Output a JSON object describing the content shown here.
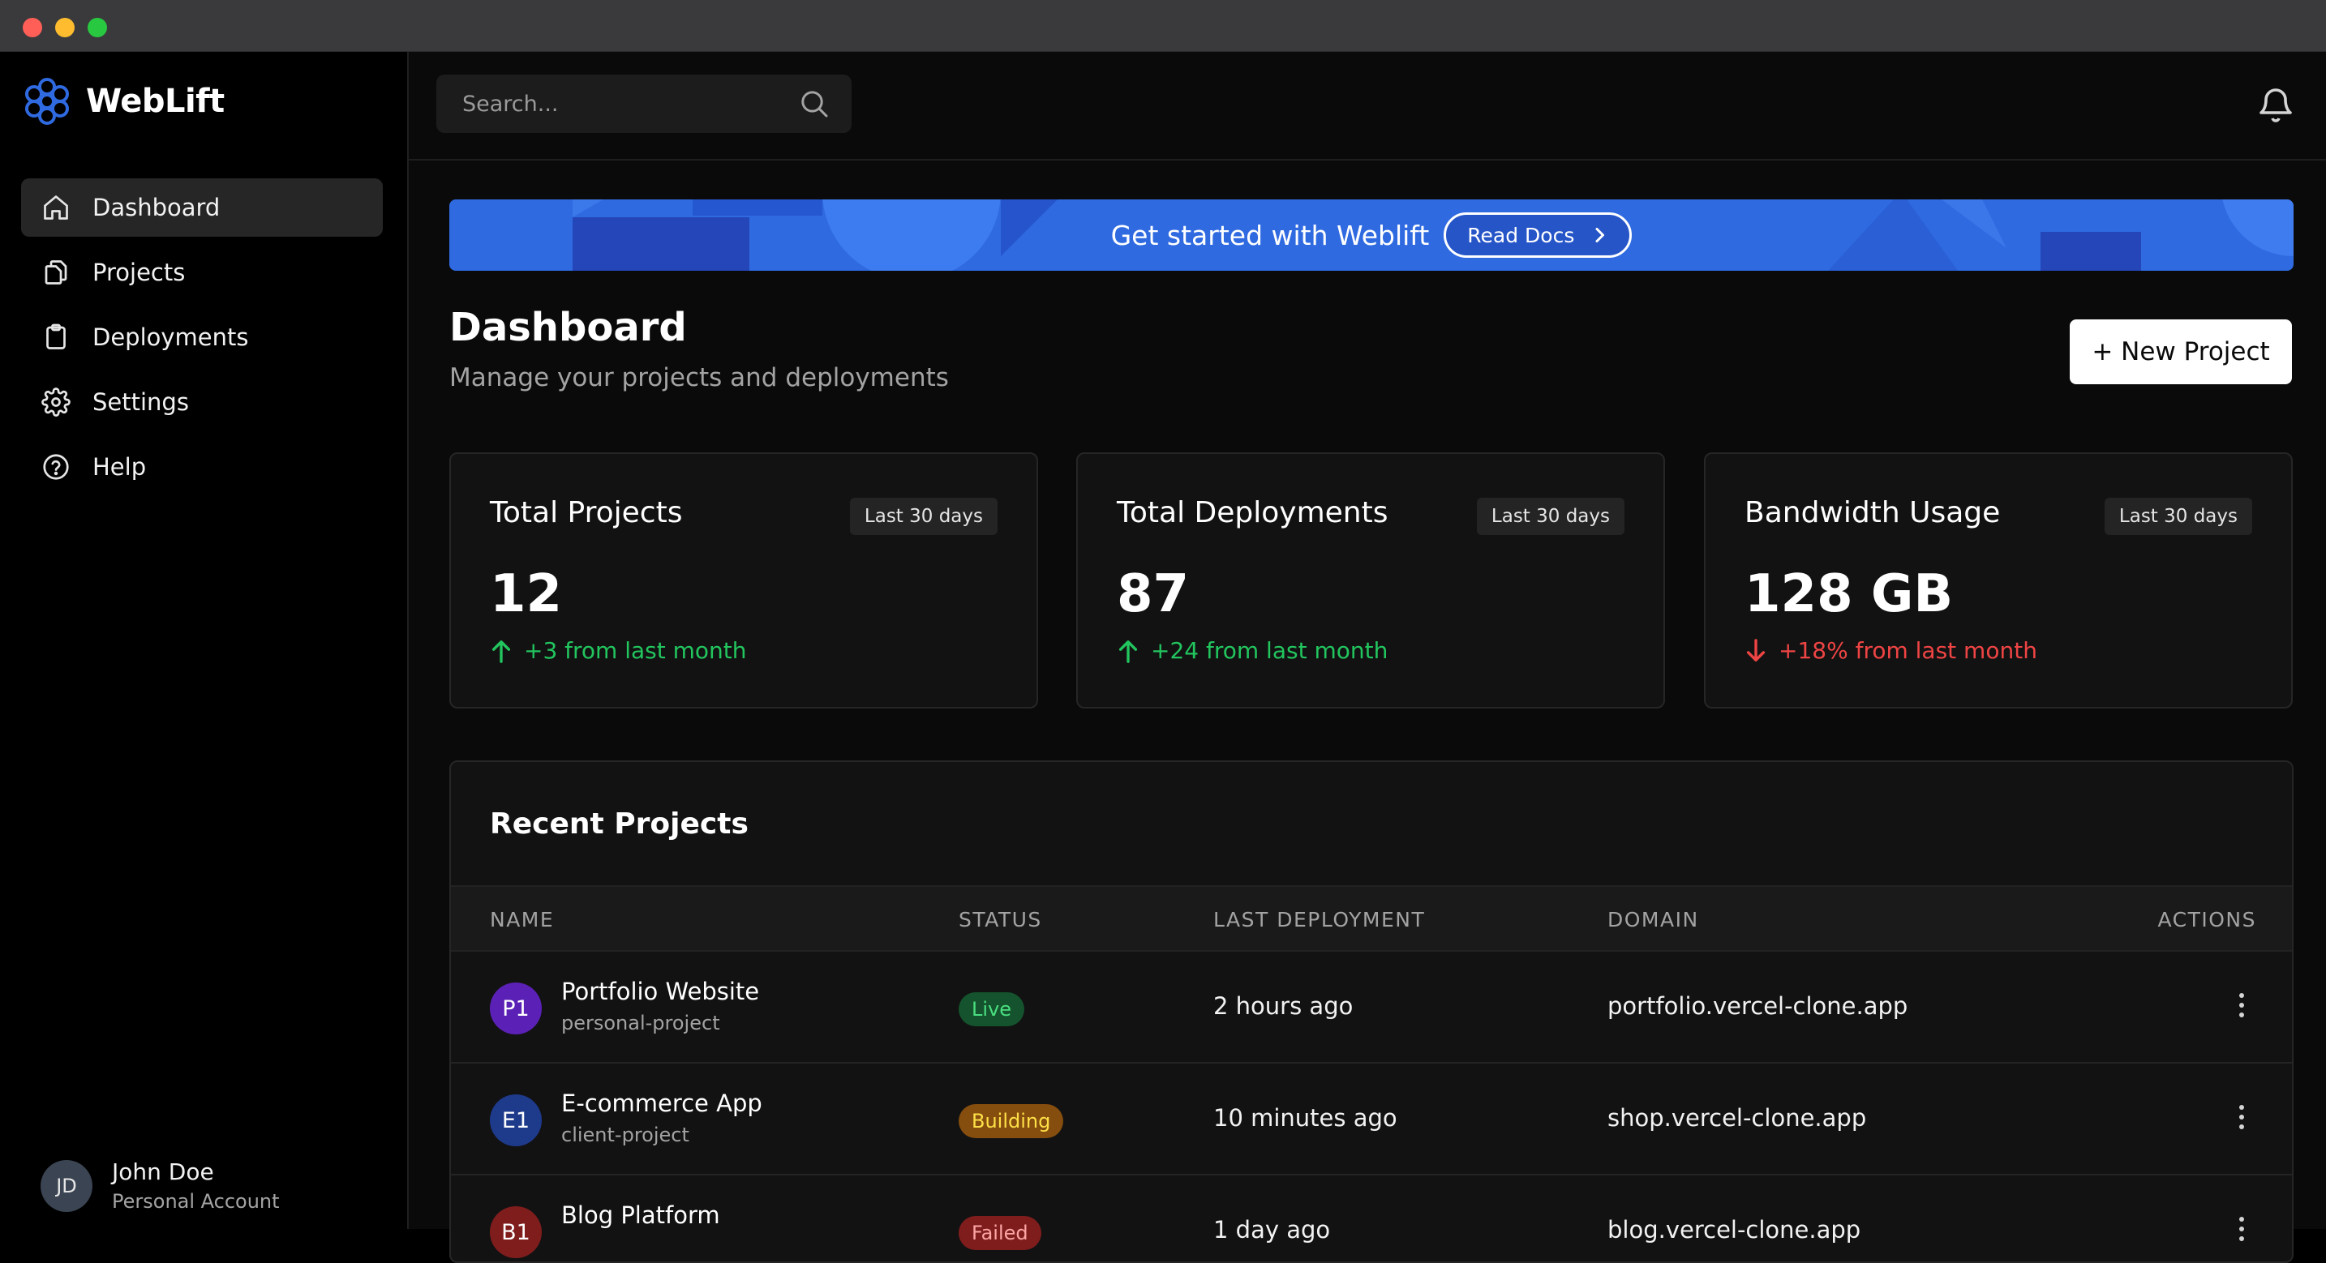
{
  "window": {
    "controls": [
      "close",
      "minimize",
      "zoom"
    ]
  },
  "brand": {
    "name": "WebLift",
    "logo_icon": "flower-logo-icon"
  },
  "sidebar": {
    "items": [
      {
        "label": "Dashboard",
        "icon": "home-icon",
        "active": true
      },
      {
        "label": "Projects",
        "icon": "copy-icon",
        "active": false
      },
      {
        "label": "Deployments",
        "icon": "clipboard-icon",
        "active": false
      },
      {
        "label": "Settings",
        "icon": "gear-icon",
        "active": false
      },
      {
        "label": "Help",
        "icon": "help-circle-icon",
        "active": false
      }
    ],
    "user": {
      "initials": "JD",
      "name": "John Doe",
      "account": "Personal Account"
    }
  },
  "topbar": {
    "search": {
      "placeholder": "Search..."
    },
    "notifications_icon": "bell-icon"
  },
  "banner": {
    "text": "Get started with Weblift",
    "button_label": "Read Docs",
    "color": "#2f6ae1"
  },
  "page": {
    "title": "Dashboard",
    "subtitle": "Manage your projects and deployments",
    "new_project_label": "+ New Project"
  },
  "stats": [
    {
      "title": "Total Projects",
      "period": "Last 30 days",
      "value": "12",
      "trend": "+3 from last month",
      "direction": "up"
    },
    {
      "title": "Total Deployments",
      "period": "Last 30 days",
      "value": "87",
      "trend": "+24 from last month",
      "direction": "up"
    },
    {
      "title": "Bandwidth Usage",
      "period": "Last 30 days",
      "value": "128 GB",
      "trend": "+18% from last month",
      "direction": "down"
    }
  ],
  "recent_projects": {
    "title": "Recent Projects",
    "columns": [
      "NAME",
      "STATUS",
      "LAST DEPLOYMENT",
      "DOMAIN",
      "ACTIONS"
    ],
    "rows": [
      {
        "initials": "P1",
        "avatar_color": "#5b21b6",
        "name": "Portfolio Website",
        "type": "personal-project",
        "status": "Live",
        "status_bg": "#14532d",
        "status_fg": "#4ade80",
        "last_deployment": "2 hours ago",
        "domain": "portfolio.vercel-clone.app"
      },
      {
        "initials": "E1",
        "avatar_color": "#1e3a8a",
        "name": "E-commerce App",
        "type": "client-project",
        "status": "Building",
        "status_bg": "#854d0e",
        "status_fg": "#fde047",
        "last_deployment": "10 minutes ago",
        "domain": "shop.vercel-clone.app"
      },
      {
        "initials": "B1",
        "avatar_color": "#7f1d1d",
        "name": "Blog Platform",
        "type": "",
        "status": "Failed",
        "status_bg": "#7f1d1d",
        "status_fg": "#fca5a5",
        "last_deployment": "1 day ago",
        "domain": "blog.vercel-clone.app"
      }
    ]
  },
  "colors": {
    "trend_up": "#22c55e",
    "trend_down": "#ef4444",
    "accent": "#2f6ae1"
  }
}
